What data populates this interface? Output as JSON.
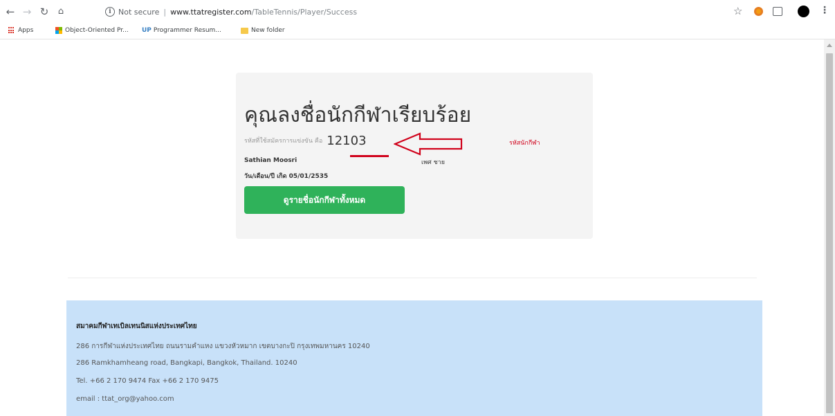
{
  "browser": {
    "url_security": "Not secure",
    "url_host": "www.ttatregister.com",
    "url_path": "/TableTennis/Player/Success",
    "bookmarks": [
      {
        "label": "Apps"
      },
      {
        "label": "Object-Oriented Pr..."
      },
      {
        "label": "Programmer Resum..."
      },
      {
        "label": "New folder"
      }
    ]
  },
  "card": {
    "title": "คุณลงชื่อนักกีฬาเรียบร้อย",
    "code_label": "รหัสที่ใช้สมัครการแข่งขัน คือ",
    "code_value": "12103",
    "annotation": "รหัสนักกีฬา",
    "player_name": "Sathian Moosri",
    "player_sex": "เพศ ชาย",
    "dob": "วัน/เดือน/ปี เกิด 05/01/2535",
    "list_button": "ดูรายชื่อนักกีฬาทั้งหมด"
  },
  "footer": {
    "org_name": "สมาคมกีฬาเทเบิลเทนนิสแห่งประเทศไทย",
    "address_th": "286 การกีฬาแห่งประเทศไทย ถนนรามคำแหง แขวงหัวหมาก เขตบางกะปิ กรุงเทพมหานคร 10240",
    "address_en": "286 Ramkhamheang road, Bangkapi, Bangkok, Thailand. 10240",
    "phone": "Tel. +66 2 170 9474 Fax +66 2 170 9475",
    "email": "email : ttat_org@yahoo.com"
  },
  "colors": {
    "button_green": "#2fb25a",
    "annotation_red": "#d0021b",
    "footer_bg": "#c8e1f9"
  }
}
